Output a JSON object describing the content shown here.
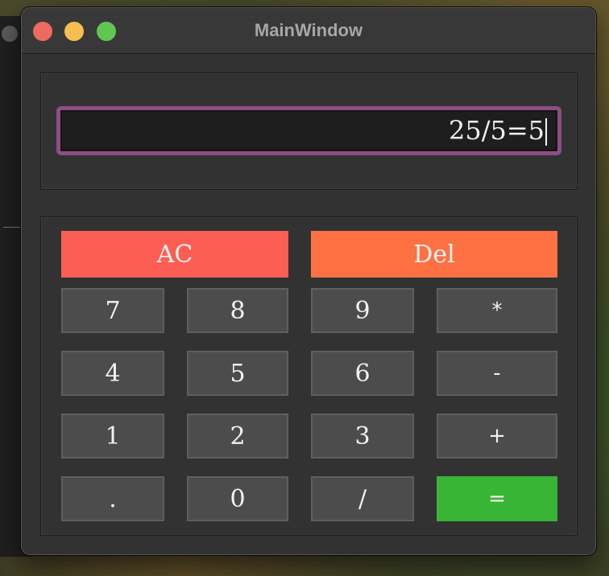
{
  "window": {
    "title": "MainWindow"
  },
  "display": {
    "value": "25/5=5"
  },
  "keys": {
    "ac": "AC",
    "del": "Del",
    "k7": "7",
    "k8": "8",
    "k9": "9",
    "mul": "*",
    "k4": "4",
    "k5": "5",
    "k6": "6",
    "sub": "-",
    "k1": "1",
    "k2": "2",
    "k3": "3",
    "add": "+",
    "dot": ".",
    "k0": "0",
    "div": "/",
    "eq": "="
  },
  "colors": {
    "ac": "#fd5e53",
    "del": "#ff7143",
    "equals": "#38b534",
    "display_border": "#8c4f83"
  }
}
